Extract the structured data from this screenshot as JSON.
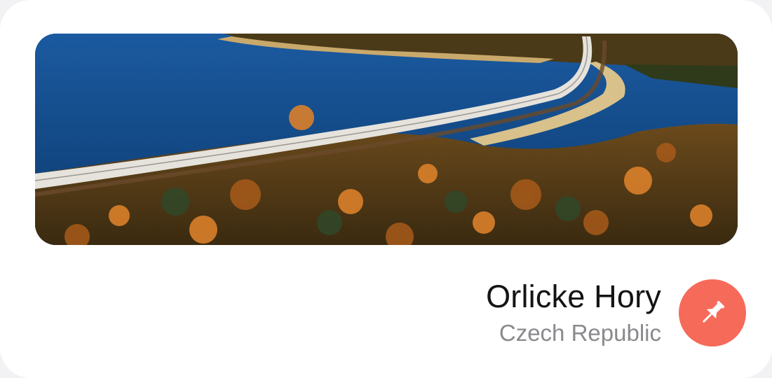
{
  "place": {
    "title": "Orlicke Hory",
    "subtitle": "Czech Republic"
  },
  "photo": {
    "subject": "aerial-lake-highway-autumn-forest"
  },
  "pin_button": {
    "icon": "pin-icon",
    "color": "#f66a5a"
  },
  "colors": {
    "card_background": "#ffffff",
    "title": "#141414",
    "subtitle": "#8a8a8e"
  }
}
